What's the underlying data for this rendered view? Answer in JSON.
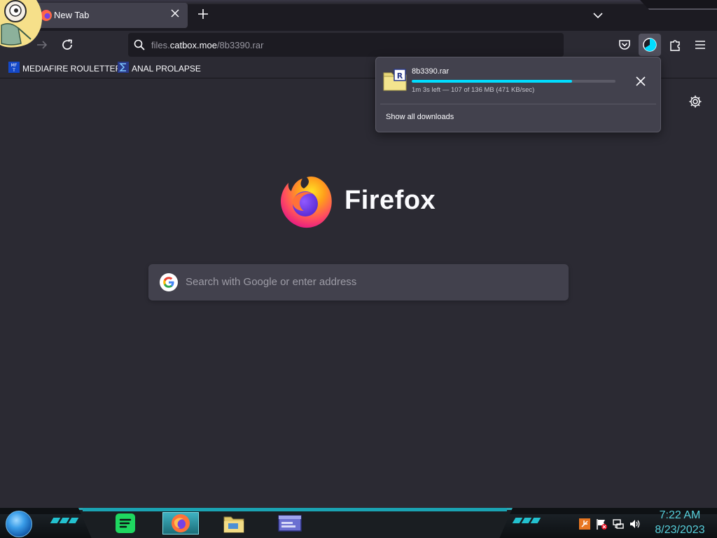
{
  "tabs": [
    {
      "title": "New Tab",
      "active": true
    }
  ],
  "urlbar": {
    "url_prefix": "files.",
    "url_host": "catbox.moe",
    "url_path": "/8b3390.rar"
  },
  "bookmarks": [
    {
      "label": "MEDIAFIRE ROULETTER",
      "icon": "mediafire-icon"
    },
    {
      "label": "ANAL PROLAPSE",
      "icon": "sigma-icon"
    }
  ],
  "newtab": {
    "logo_text": "Firefox",
    "search_placeholder": "Search with Google or enter address"
  },
  "downloads": {
    "file_name": "8b3390.rar",
    "progress": 0.787,
    "status": "1m 3s left — 107 of 136 MB (471 KB/sec)",
    "show_all": "Show all downloads"
  },
  "taskbar": {
    "apps": [
      "spotify-icon",
      "firefox-icon",
      "file-explorer-icon",
      "window-app-icon"
    ],
    "clock_time": "7:22 AM",
    "clock_date": "8/23/2023"
  },
  "colors": {
    "accent": "#00ddff",
    "taskbar_accent": "#57d0dc",
    "background": "#2b2a33"
  }
}
